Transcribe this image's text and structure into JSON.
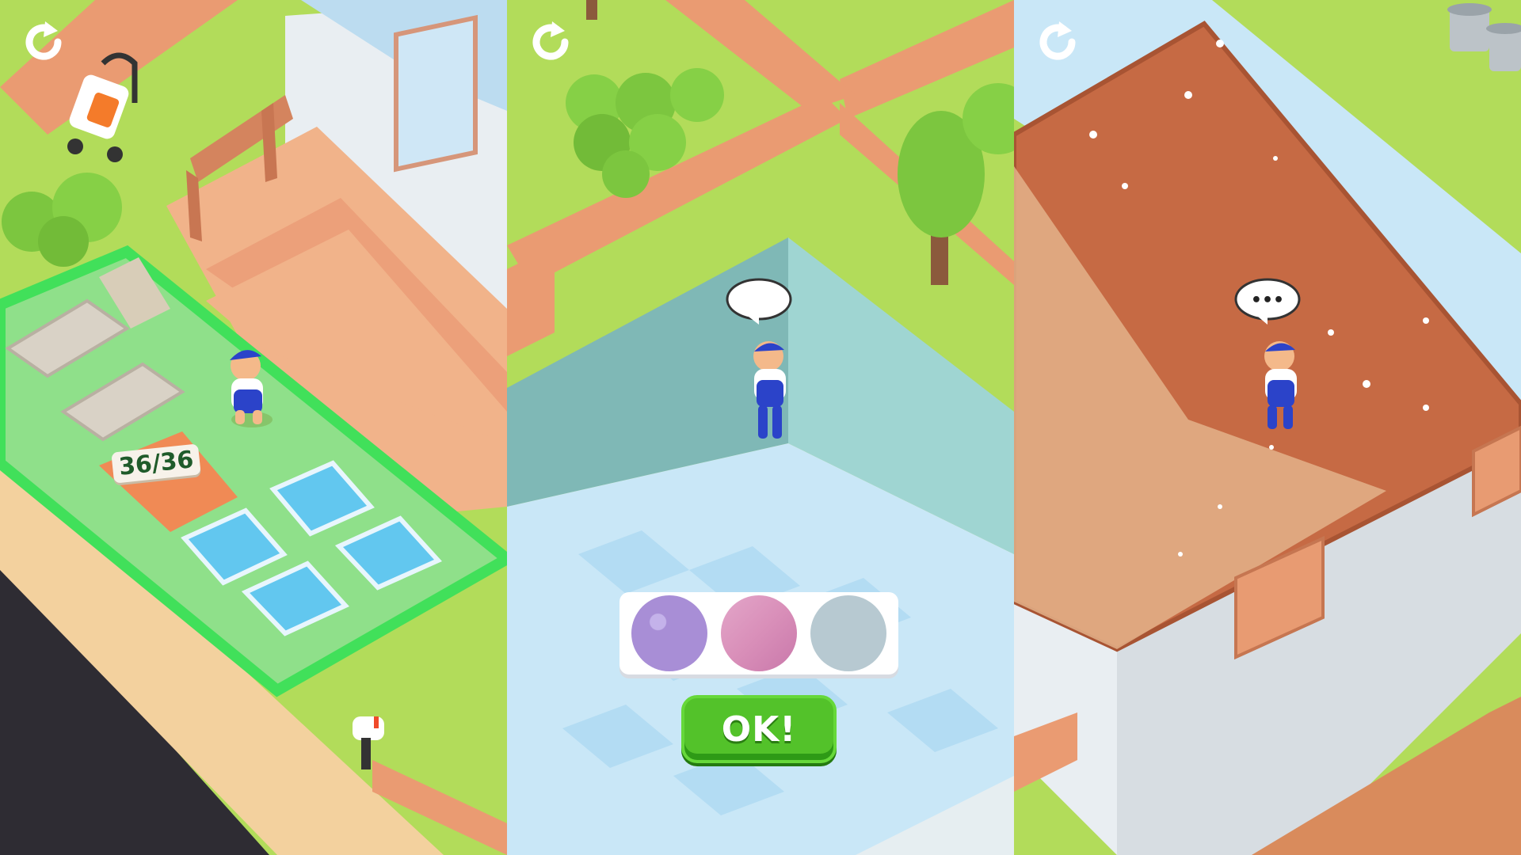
{
  "panels": [
    {
      "name": "yard",
      "restart_icon": "restart-icon",
      "counter": "36/36"
    },
    {
      "name": "pool",
      "restart_icon": "restart-icon",
      "speech_bubble": ""
    },
    {
      "name": "roof",
      "restart_icon": "restart-icon",
      "speech_bubble": "•••"
    }
  ],
  "swatches": [
    {
      "name": "purple-spotted",
      "color": "#a88ed6"
    },
    {
      "name": "pink-marble",
      "color": "#d98fb9"
    },
    {
      "name": "light-blue-gray",
      "color": "#b7c9d1"
    }
  ],
  "ok_button": {
    "label": "OK!"
  },
  "colors": {
    "grass": "#b2dc5a",
    "fence": "#ea9b72",
    "deck": "#f1b38a",
    "pool_floor": "#c9e7f7",
    "roof": "#c66a44",
    "worker_shirt": "#2b43c9",
    "ok_green": "#53c22a",
    "selection_green": "#41e05a"
  }
}
